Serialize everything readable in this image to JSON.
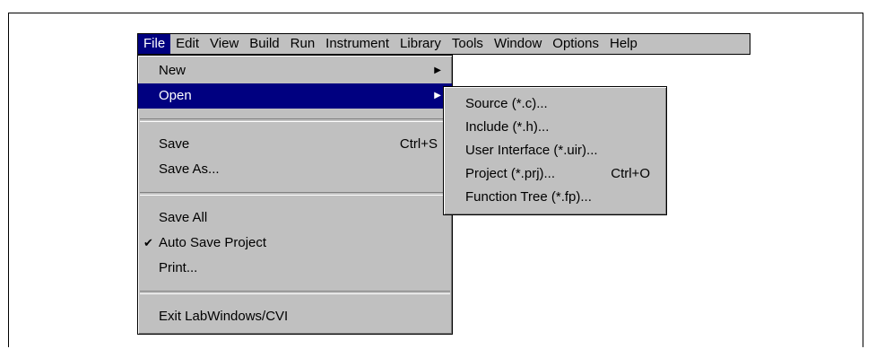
{
  "menubar": {
    "items": [
      {
        "label": "File",
        "active": true
      },
      {
        "label": "Edit"
      },
      {
        "label": "View"
      },
      {
        "label": "Build"
      },
      {
        "label": "Run"
      },
      {
        "label": "Instrument"
      },
      {
        "label": "Library"
      },
      {
        "label": "Tools"
      },
      {
        "label": "Window"
      },
      {
        "label": "Options"
      },
      {
        "label": "Help"
      }
    ]
  },
  "file_menu": {
    "new": {
      "label": "New",
      "arrow": "▶"
    },
    "open": {
      "label": "Open",
      "arrow": "▶"
    },
    "save": {
      "label": "Save",
      "shortcut": "Ctrl+S"
    },
    "save_as": {
      "label": "Save As..."
    },
    "save_all": {
      "label": "Save All"
    },
    "auto_save_project": {
      "label": "Auto Save Project",
      "check": "✔"
    },
    "print": {
      "label": "Print..."
    },
    "exit": {
      "label": "Exit LabWindows/CVI"
    }
  },
  "open_submenu": {
    "source": {
      "label": "Source (*.c)..."
    },
    "include": {
      "label": "Include (*.h)..."
    },
    "user_interface": {
      "label": "User Interface (*.uir)..."
    },
    "project": {
      "label": "Project (*.prj)...",
      "shortcut": "Ctrl+O"
    },
    "function_tree": {
      "label": "Function Tree (*.fp)..."
    }
  },
  "colors": {
    "menu_bg": "#c0c0c0",
    "highlight": "#000080"
  }
}
